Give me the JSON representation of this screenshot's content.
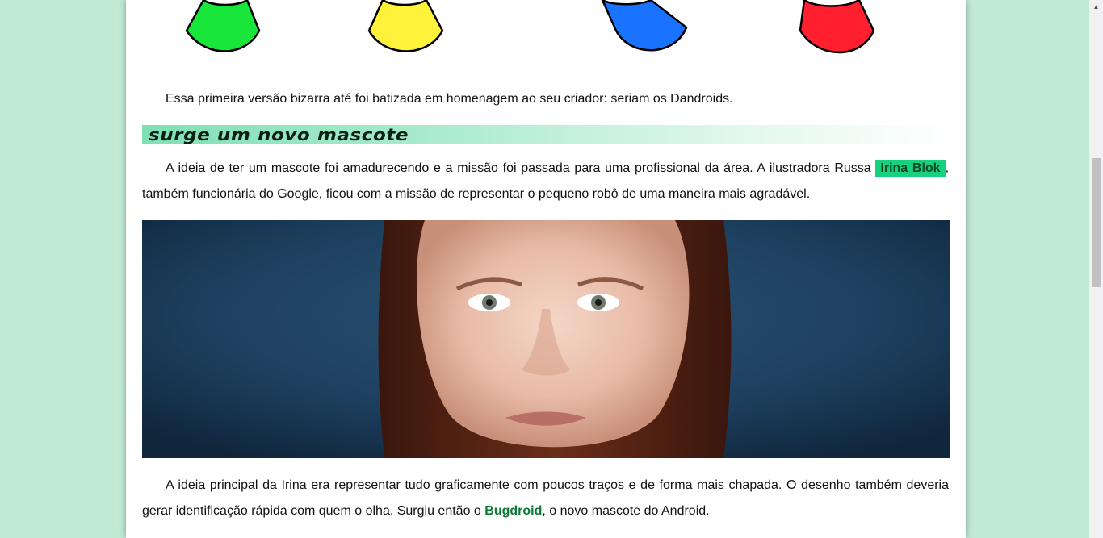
{
  "article": {
    "para1": "Essa primeira versão bizarra até foi batizada em homenagem ao seu criador: seriam os Dandroids.",
    "heading": "Surge um novo mascote",
    "para2_before": "A ideia de ter um mascote foi amadurecendo e a missão foi passada para uma profissional da área. A ilustradora Russa ",
    "para2_highlight": "Irina Blok",
    "para2_after": ", também funcionária do Google, ficou com a missão de representar o pequeno robô de uma maneira mais agradável.",
    "para3_before": "A ideia principal da Irina era representar tudo graficamente com poucos traços e de forma mais chapada. O desenho também deveria gerar identificação rápida com quem o olha. Surgiu então o ",
    "para3_link": "Bugdroid",
    "para3_after": ", o novo mascote do Android."
  },
  "figures": [
    {
      "name": "green-dandroid-figure",
      "color": "#19e63a"
    },
    {
      "name": "yellow-dandroid-figure",
      "color": "#fff23a"
    },
    {
      "name": "blue-dandroid-figure",
      "color": "#1a73ff"
    },
    {
      "name": "red-dandroid-figure",
      "color": "#ff1f2e"
    }
  ],
  "colors": {
    "background": "#c0ead4",
    "highlight": "#17d17e",
    "link": "#0d7a35"
  },
  "scrollbar": {
    "up_arrow_icon": "triangle-up-icon"
  }
}
